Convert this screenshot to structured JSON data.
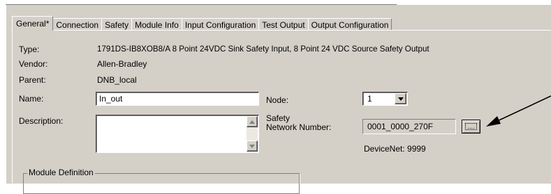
{
  "tabs": [
    {
      "label": "General*",
      "active": true
    },
    {
      "label": "Connection",
      "active": false
    },
    {
      "label": "Safety",
      "active": false
    },
    {
      "label": "Module Info",
      "active": false
    },
    {
      "label": "Input Configuration",
      "active": false
    },
    {
      "label": "Test Output",
      "active": false
    },
    {
      "label": "Output Configuration",
      "active": false
    }
  ],
  "general": {
    "type_label": "Type:",
    "type_value": "1791DS-IB8XOB8/A 8 Point 24VDC Sink Safety Input, 8 Point 24 VDC Source Safety Output",
    "vendor_label": "Vendor:",
    "vendor_value": "Allen-Bradley",
    "parent_label": "Parent:",
    "parent_value": "DNB_local",
    "name_label": "Name:",
    "name_value": "In_out",
    "description_label": "Description:",
    "description_value": "",
    "node_label": "Node:",
    "node_value": "1",
    "safety_network_label_1": "Safety",
    "safety_network_label_2": "Network Number:",
    "safety_network_value": "0001_0000_270F",
    "browse_button": "....",
    "devicenet_text": "DeviceNet: 9999",
    "module_definition_title": "Module Definition"
  },
  "icons": {
    "scroll_up": "scroll-up-arrow-icon",
    "scroll_down": "scroll-down-arrow-icon",
    "dropdown": "chevron-down-icon",
    "pointer": "arrow-annotation-icon"
  }
}
